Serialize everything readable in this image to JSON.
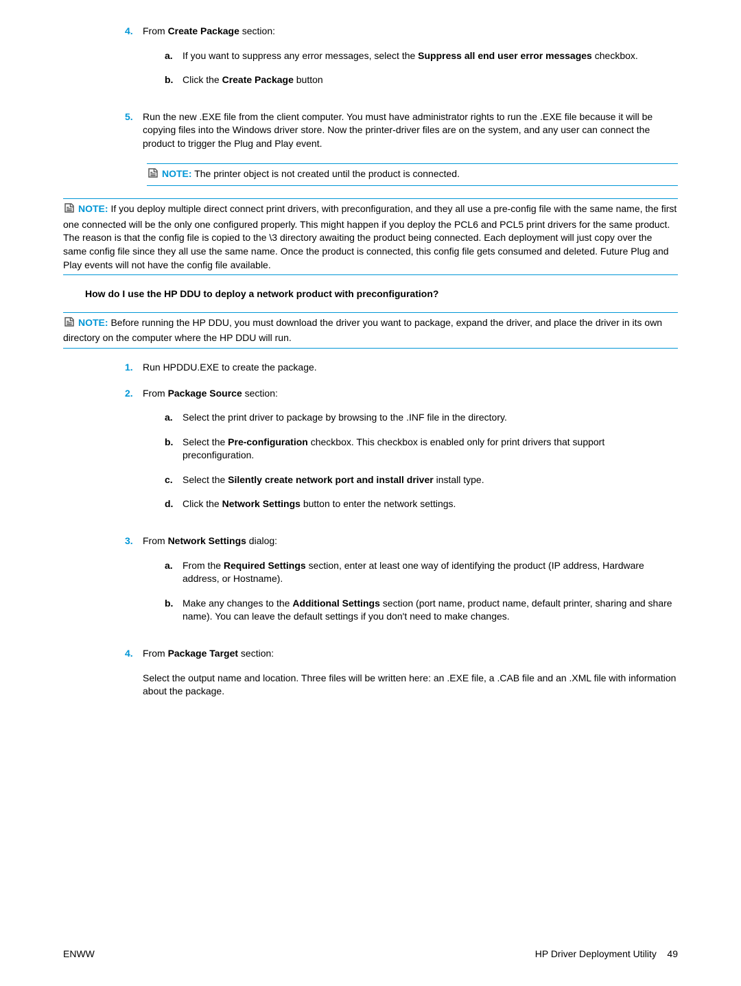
{
  "items": {
    "i4": {
      "num": "4.",
      "text_pre": "From ",
      "b1": "Create Package",
      "text_post": " section:"
    },
    "i4a": {
      "letter": "a.",
      "t1": "If you want to suppress any error messages, select the ",
      "b1": "Suppress all end user error messages",
      "t2": " checkbox."
    },
    "i4b": {
      "letter": "b.",
      "t1": "Click the ",
      "b1": "Create Package",
      "t2": " button"
    },
    "i5": {
      "num": "5.",
      "text": "Run the new .EXE file from the client computer. You must have administrator rights to run the .EXE file because it will be copying files into the Windows driver store. Now the printer-driver files are on the system, and any user can connect the product to trigger the Plug and Play event."
    },
    "note1": {
      "label": "NOTE:",
      "text": "   The printer object is not created until the product is connected."
    },
    "note2": {
      "label": "NOTE:",
      "text": "   If you deploy multiple direct connect print drivers, with preconfiguration, and they all use a pre-config file with the same name, the first one connected will be the only one configured properly. This might happen if you deploy the PCL6 and PCL5 print drivers for the same product. The reason is that the config file is copied to the \\3 directory awaiting the product being connected. Each deployment will just copy over the same config file since they all use the same name. Once the product is connected, this config file gets consumed and deleted. Future Plug and Play events will not have the config file available."
    },
    "heading2": "How do I use the HP DDU to deploy a network product with preconfiguration?",
    "note3": {
      "label": "NOTE:",
      "text": "   Before running the HP DDU, you must download the driver you want to package, expand the driver, and place the driver in its own directory on the computer where the HP DDU will run."
    },
    "n1": {
      "num": "1.",
      "text": "Run HPDDU.EXE to create the package."
    },
    "n2": {
      "num": "2.",
      "t1": "From ",
      "b1": "Package Source",
      "t2": " section:"
    },
    "n2a": {
      "letter": "a.",
      "text": "Select the print driver to package by browsing to the .INF file in the directory."
    },
    "n2b": {
      "letter": "b.",
      "t1": "Select the ",
      "b1": "Pre-configuration",
      "t2": " checkbox. This checkbox is enabled only for print drivers that support preconfiguration."
    },
    "n2c": {
      "letter": "c.",
      "t1": "Select the ",
      "b1": "Silently create network port and install driver",
      "t2": " install type."
    },
    "n2d": {
      "letter": "d.",
      "t1": "Click the ",
      "b1": "Network Settings",
      "t2": " button to enter the network settings."
    },
    "n3": {
      "num": "3.",
      "t1": "From ",
      "b1": "Network Settings",
      "t2": " dialog:"
    },
    "n3a": {
      "letter": "a.",
      "t1": "From the ",
      "b1": "Required Settings",
      "t2": " section, enter at least one way of identifying the product (IP address, Hardware address, or Hostname)."
    },
    "n3b": {
      "letter": "b.",
      "t1": "Make any changes to the ",
      "b1": "Additional Settings",
      "t2": " section (port name, product name, default printer, sharing and share name). You can leave the default settings if you don't need to make changes."
    },
    "n4": {
      "num": "4.",
      "t1": "From ",
      "b1": "Package Target",
      "t2": " section:"
    },
    "n4desc": "Select the output name and location. Three files will be written here: an .EXE file, a .CAB file and an .XML file with information about the package."
  },
  "footer": {
    "left": "ENWW",
    "right_text": "HP Driver Deployment Utility",
    "right_page": "49"
  }
}
